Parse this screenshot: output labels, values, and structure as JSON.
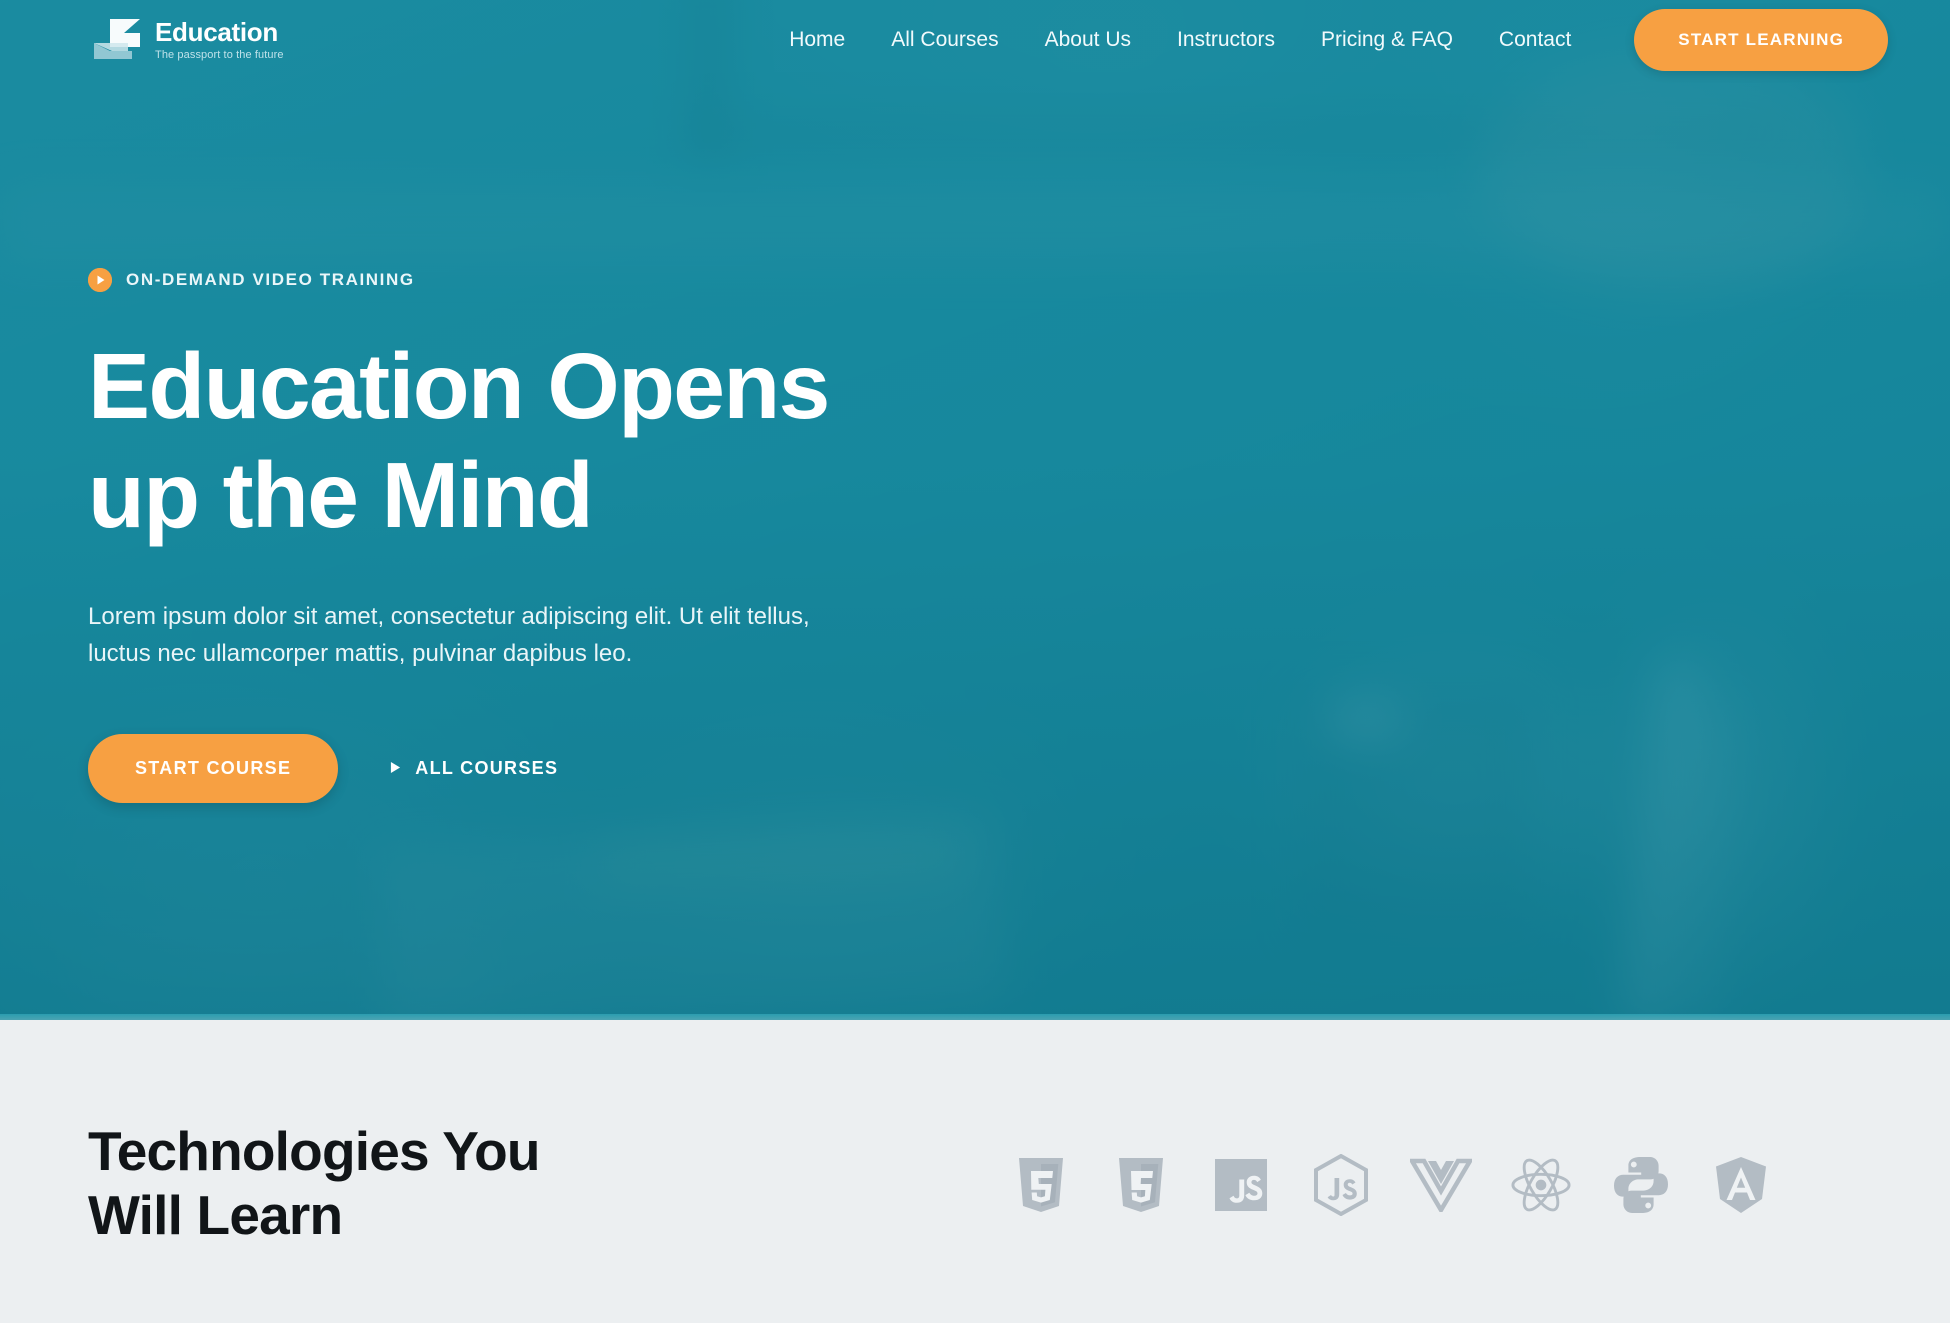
{
  "brand": {
    "name": "Education",
    "tagline": "The passport to the future",
    "logo_icon": "arrow-flag-logo-icon",
    "accent_color": "#f7a042",
    "teal_color": "#17899e",
    "light_section_color": "#eceff1"
  },
  "header": {
    "nav": [
      {
        "label": "Home",
        "name": "nav-home"
      },
      {
        "label": "All Courses",
        "name": "nav-all-courses"
      },
      {
        "label": "About Us",
        "name": "nav-about-us"
      },
      {
        "label": "Instructors",
        "name": "nav-instructors"
      },
      {
        "label": "Pricing & FAQ",
        "name": "nav-pricing-faq"
      },
      {
        "label": "Contact",
        "name": "nav-contact"
      }
    ],
    "cta_label": "START LEARNING"
  },
  "hero": {
    "eyebrow": "ON-DEMAND VIDEO TRAINING",
    "eyebrow_icon": "play-circle-icon",
    "title_line1": "Education Opens",
    "title_line2": "up the Mind",
    "desc_line1": "Lorem ipsum dolor sit amet, consectetur adipiscing elit. Ut elit tellus,",
    "desc_line2": "luctus nec ullamcorper mattis, pulvinar dapibus leo.",
    "primary_cta": "START COURSE",
    "secondary_cta": "ALL COURSES",
    "secondary_cta_icon": "play-triangle-icon"
  },
  "technologies": {
    "title_line1": "Technologies You",
    "title_line2": "Will Learn",
    "logos": [
      {
        "name": "html5-icon",
        "label": "HTML5"
      },
      {
        "name": "css3-icon",
        "label": "CSS3"
      },
      {
        "name": "javascript-icon",
        "label": "JavaScript"
      },
      {
        "name": "nodejs-icon",
        "label": "Node.js"
      },
      {
        "name": "vuejs-icon",
        "label": "Vue.js"
      },
      {
        "name": "react-icon",
        "label": "React"
      },
      {
        "name": "python-icon",
        "label": "Python"
      },
      {
        "name": "angular-icon",
        "label": "Angular"
      }
    ]
  }
}
